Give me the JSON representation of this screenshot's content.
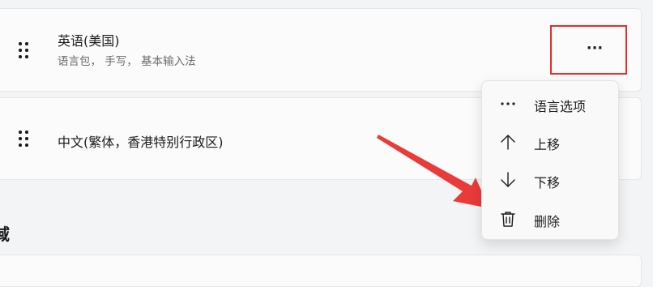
{
  "languages": [
    {
      "name": "英语(美国)",
      "details": "语言包， 手写， 基本输入法"
    },
    {
      "name": "中文(繁体，香港特别行政区)"
    }
  ],
  "more_button": {
    "label": "···"
  },
  "section_heading": "域",
  "context_menu": {
    "items": [
      {
        "label": "语言选项",
        "icon": "more-horizontal-icon"
      },
      {
        "label": "上移",
        "icon": "arrow-up-icon"
      },
      {
        "label": "下移",
        "icon": "arrow-down-icon"
      },
      {
        "label": "删除",
        "icon": "trash-icon"
      }
    ]
  },
  "annotation": {
    "highlight_color": "#e52d2d",
    "arrow_color": "#ea3a3a"
  }
}
